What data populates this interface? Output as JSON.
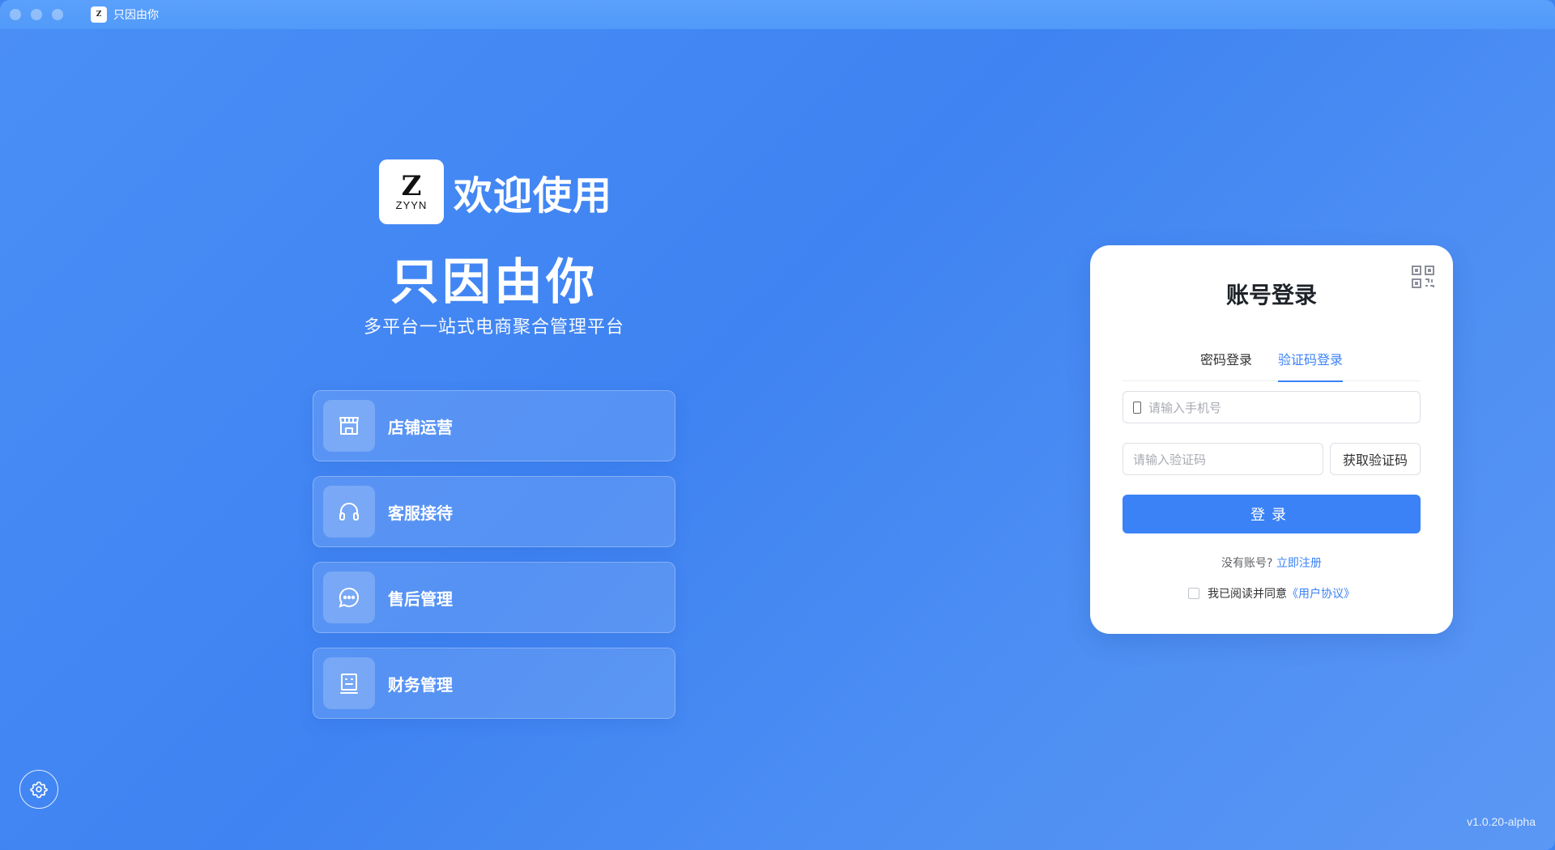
{
  "window": {
    "title": "只因由你",
    "logo_mark": "Z"
  },
  "hero": {
    "logo_mark": "Z",
    "logo_text": "ZYYN",
    "welcome": "欢迎使用",
    "brand": "只因由你",
    "slogan": "多平台一站式电商聚合管理平台"
  },
  "features": [
    {
      "label": "店铺运营",
      "icon": "store-icon"
    },
    {
      "label": "客服接待",
      "icon": "headset-icon"
    },
    {
      "label": "售后管理",
      "icon": "chat-icon"
    },
    {
      "label": "财务管理",
      "icon": "finance-icon"
    }
  ],
  "login": {
    "title": "账号登录",
    "tabs": [
      {
        "label": "密码登录",
        "active": false
      },
      {
        "label": "验证码登录",
        "active": true
      }
    ],
    "phone_placeholder": "请输入手机号",
    "code_placeholder": "请输入验证码",
    "get_code_label": "获取验证码",
    "submit_label": "登录",
    "no_account_text": "没有账号?",
    "register_link": "立即注册",
    "agree_text": "我已阅读并同意",
    "agreement_link": "《用户协议》"
  },
  "version": "v1.0.20-alpha",
  "colors": {
    "accent": "#3b82f6",
    "background": "#3f84f1"
  }
}
